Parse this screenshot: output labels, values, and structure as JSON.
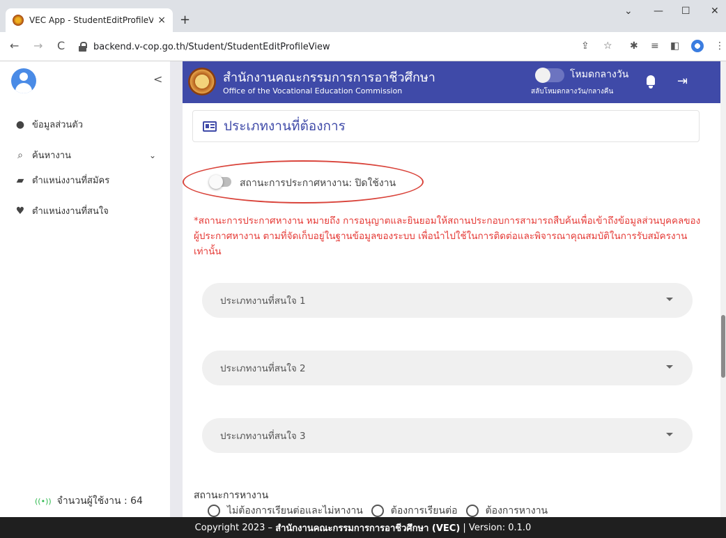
{
  "browser": {
    "tab_title": "VEC App - StudentEditProfileVie",
    "tab_close": "×",
    "new_tab": "+",
    "url": "backend.v-cop.go.th/Student/StudentEditProfileView",
    "controls": {
      "minimize": "—",
      "maximize": "☐",
      "close": "✕",
      "tab_search": "⌄"
    },
    "nav": {
      "back": "←",
      "forward": "→",
      "reload": "C"
    },
    "toolbar_glyphs": {
      "share": "⇪",
      "bookmark": "☆",
      "extensions": "✱",
      "reading_list": "≡",
      "sidepanel": "◧",
      "menu": "⋮"
    }
  },
  "sidebar": {
    "collapse_glyph": "<",
    "items": [
      {
        "label": "ข้อมูลส่วนตัว",
        "icon": "person-icon"
      },
      {
        "label": "ค้นหางาน",
        "icon": "job-search-icon",
        "chevron": "⌄"
      },
      {
        "label": "ตำแหน่งงานที่สมัคร",
        "icon": "applied-job-icon"
      },
      {
        "label": "ตำแหน่งงานที่สนใจ",
        "icon": "heart-icon"
      }
    ],
    "user_count": {
      "icon_glyph": "((•))",
      "label": "จำนวนผู้ใช้งาน : 64"
    }
  },
  "header": {
    "org_th": "สำนักงานคณะกรรมการการอาชีวศึกษา",
    "org_en": "Office of the Vocational Education Commission",
    "day_mode": "โหมดกลางวัน",
    "day_mode_sub": "สลับโหมดกลางวัน/กลางคืน",
    "logout_glyph": "⇥"
  },
  "content": {
    "section_title": "ประเภทงานที่ต้องการ",
    "announce_status": "สถานะการประกาศหางาน: ปิดใช้งาน",
    "notice": "*สถานะการประกาศหางาน หมายถึง การอนุญาตและยินยอมให้สถานประกอบการสามารถสืบค้นเพื่อเข้าถึงข้อมูลส่วนบุคคลของผู้ประกาศหางาน ตามที่จัดเก็บอยู่ในฐานข้อมูลของระบบ เพื่อนำไปใช้ในการติดต่อและพิจารณาคุณสมบัติในการรับสมัครงานเท่านั้น",
    "selects": [
      "ประเภทงานที่สนใจ 1",
      "ประเภทงานที่สนใจ 2",
      "ประเภทงานที่สนใจ 3"
    ],
    "job_status_label": "สถานะการหางาน",
    "radio_options": [
      "ไม่ต้องการเรียนต่อและไม่หางาน",
      "ต้องการเรียนต่อ",
      "ต้องการหางาน"
    ]
  },
  "footer": {
    "prefix": "Copyright 2023 –",
    "org": "สำนักงานคณะกรรมการการอาชีวศึกษา (VEC)",
    "suffix": "| Version: 0.1.0"
  },
  "colors": {
    "primary": "#3f4aa8",
    "notice": "#e53935",
    "highlight_oval": "#d9433a",
    "footer_bg": "#1f1f1f"
  }
}
